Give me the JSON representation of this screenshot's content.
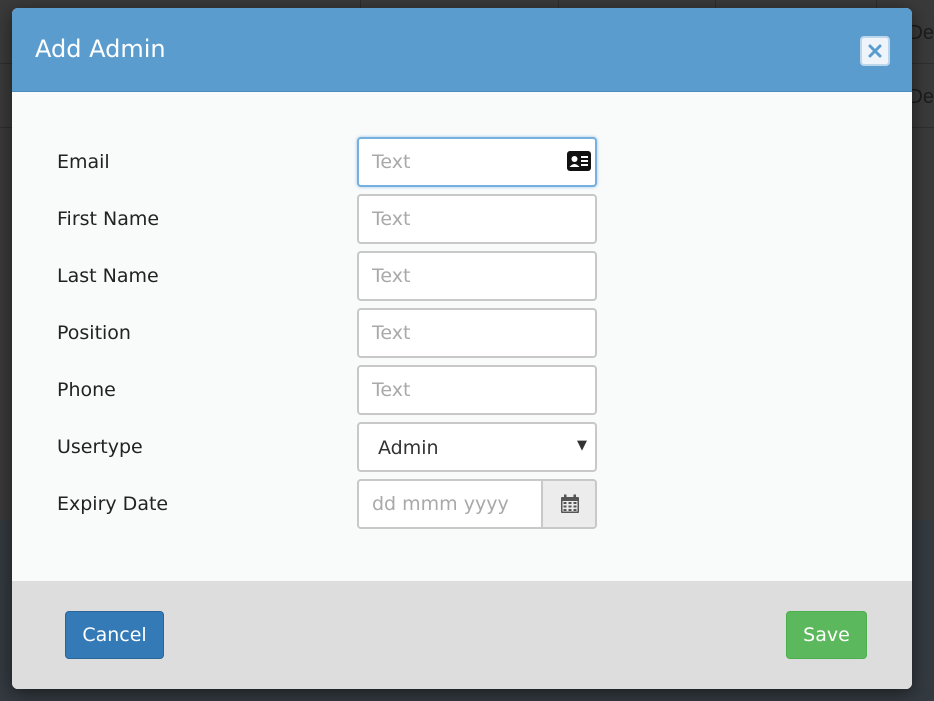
{
  "background": {
    "row_text_1": "De",
    "row_text_2": "De"
  },
  "modal": {
    "title": "Add Admin",
    "close_icon": "close-icon",
    "fields": {
      "email": {
        "label": "Email",
        "placeholder": "Text",
        "value": "",
        "icon": "contact-card-icon"
      },
      "first_name": {
        "label": "First Name",
        "placeholder": "Text",
        "value": ""
      },
      "last_name": {
        "label": "Last Name",
        "placeholder": "Text",
        "value": ""
      },
      "position": {
        "label": "Position",
        "placeholder": "Text",
        "value": ""
      },
      "phone": {
        "label": "Phone",
        "placeholder": "Text",
        "value": ""
      },
      "usertype": {
        "label": "Usertype",
        "selected": "Admin"
      },
      "expiry_date": {
        "label": "Expiry Date",
        "placeholder": "dd mmm yyyy",
        "value": "",
        "icon": "calendar-icon"
      }
    },
    "footer": {
      "cancel_label": "Cancel",
      "save_label": "Save"
    }
  },
  "colors": {
    "header": "#5b9ccf",
    "cancel": "#337ab7",
    "save": "#5cb85c",
    "footer": "#dddddd"
  }
}
